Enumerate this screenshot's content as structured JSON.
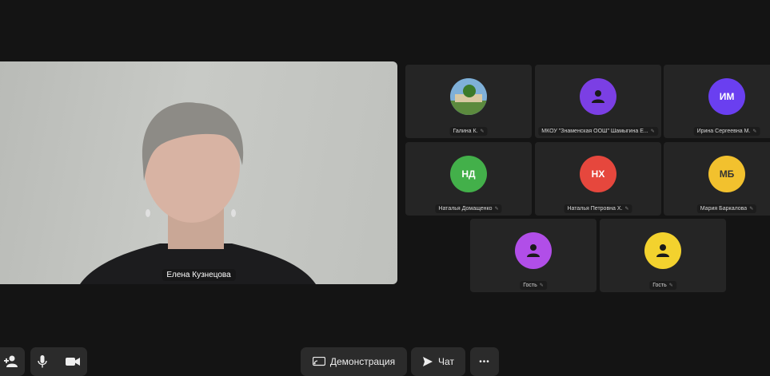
{
  "main_speaker": {
    "name": "Елена Кузнецова"
  },
  "participants": [
    {
      "name": "Галина К.",
      "initials": "",
      "color": "#3a6f9a",
      "avatar": "photo"
    },
    {
      "name": "МКОУ \"Знаменская ООШ\" Шамыгина Е...",
      "initials": "",
      "color": "#7b3fe4",
      "avatar": "person-icon"
    },
    {
      "name": "Ирина Сергеевна М.",
      "initials": "ИМ",
      "color": "#6a3ff0",
      "avatar": "initials"
    },
    {
      "name": "Наталья Домащенко",
      "initials": "НД",
      "color": "#43b04a",
      "avatar": "initials"
    },
    {
      "name": "Наталья Петровна Х.",
      "initials": "НХ",
      "color": "#e6473d",
      "avatar": "initials"
    },
    {
      "name": "Мария Баркалова",
      "initials": "МБ",
      "color": "#f2c12e",
      "avatar": "initials"
    },
    {
      "name": "Гость",
      "initials": "",
      "color": "#b14ee8",
      "avatar": "person-icon"
    },
    {
      "name": "Гость",
      "initials": "",
      "color": "#f3d22e",
      "avatar": "person-icon"
    }
  ],
  "toolbar": {
    "demo_label": "Демонстрация",
    "chat_label": "Чат",
    "more_label": "•••"
  }
}
